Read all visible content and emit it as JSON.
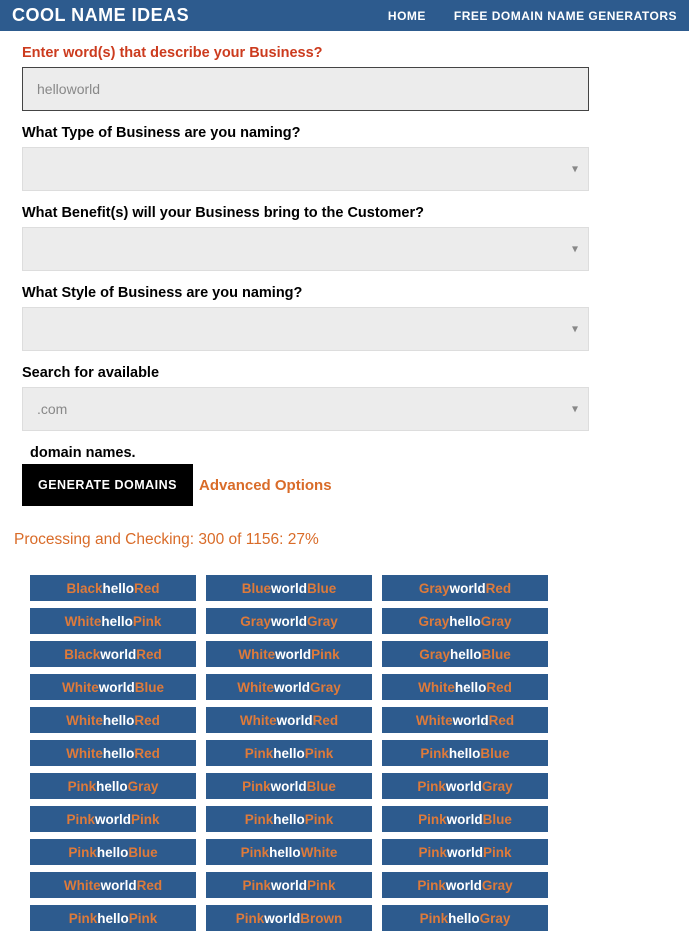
{
  "header": {
    "title": "COOL NAME IDEAS",
    "nav": {
      "home": "HOME",
      "gen": "FREE DOMAIN NAME GENERATORS"
    }
  },
  "form": {
    "q1": "Enter word(s) that describe your Business?",
    "q1_value": "helloworld",
    "q2": "What Type of Business are you naming?",
    "q3": "What Benefit(s) will your Business bring to the Customer?",
    "q4": "What Style of Business are you naming?",
    "q5": "Search for available",
    "q5_value": ".com",
    "q5_tail": "domain names.",
    "gen_btn": "GENERATE DOMAINS",
    "adv": "Advanced Options"
  },
  "status": "Processing and Checking: 300 of 1156: 27%",
  "results": {
    "col1": [
      [
        {
          "t": "Black",
          "c": "o"
        },
        {
          "t": "hello",
          "c": "w"
        },
        {
          "t": "Red",
          "c": "o"
        }
      ],
      [
        {
          "t": "White",
          "c": "o"
        },
        {
          "t": "hello",
          "c": "w"
        },
        {
          "t": "Pink",
          "c": "o"
        }
      ],
      [
        {
          "t": "Black",
          "c": "o"
        },
        {
          "t": "world",
          "c": "w"
        },
        {
          "t": "Red",
          "c": "o"
        }
      ],
      [
        {
          "t": "White",
          "c": "o"
        },
        {
          "t": "world",
          "c": "w"
        },
        {
          "t": "Blue",
          "c": "o"
        }
      ],
      [
        {
          "t": "White",
          "c": "o"
        },
        {
          "t": "hello",
          "c": "w"
        },
        {
          "t": "Red",
          "c": "o"
        }
      ],
      [
        {
          "t": "White",
          "c": "o"
        },
        {
          "t": "hello",
          "c": "w"
        },
        {
          "t": "Red",
          "c": "o"
        }
      ],
      [
        {
          "t": "Pink",
          "c": "o"
        },
        {
          "t": "hello",
          "c": "w"
        },
        {
          "t": "Gray",
          "c": "o"
        }
      ],
      [
        {
          "t": "Pink",
          "c": "o"
        },
        {
          "t": "world",
          "c": "w"
        },
        {
          "t": "Pink",
          "c": "o"
        }
      ],
      [
        {
          "t": "Pink",
          "c": "o"
        },
        {
          "t": "hello",
          "c": "w"
        },
        {
          "t": "Blue",
          "c": "o"
        }
      ],
      [
        {
          "t": "White",
          "c": "o"
        },
        {
          "t": "world",
          "c": "w"
        },
        {
          "t": "Red",
          "c": "o"
        }
      ],
      [
        {
          "t": "Pink",
          "c": "o"
        },
        {
          "t": "hello",
          "c": "w"
        },
        {
          "t": "Pink",
          "c": "o"
        }
      ]
    ],
    "col2": [
      [
        {
          "t": "Blue",
          "c": "o"
        },
        {
          "t": "world",
          "c": "w"
        },
        {
          "t": "Blue",
          "c": "o"
        }
      ],
      [
        {
          "t": "Gray",
          "c": "o"
        },
        {
          "t": "world",
          "c": "w"
        },
        {
          "t": "Gray",
          "c": "o"
        }
      ],
      [
        {
          "t": "White",
          "c": "o"
        },
        {
          "t": "world",
          "c": "w"
        },
        {
          "t": "Pink",
          "c": "o"
        }
      ],
      [
        {
          "t": "White",
          "c": "o"
        },
        {
          "t": "world",
          "c": "w"
        },
        {
          "t": "Gray",
          "c": "o"
        }
      ],
      [
        {
          "t": "White",
          "c": "o"
        },
        {
          "t": "world",
          "c": "w"
        },
        {
          "t": "Red",
          "c": "o"
        }
      ],
      [
        {
          "t": "Pink",
          "c": "o"
        },
        {
          "t": "hello",
          "c": "w"
        },
        {
          "t": "Pink",
          "c": "o"
        }
      ],
      [
        {
          "t": "Pink",
          "c": "o"
        },
        {
          "t": "world",
          "c": "w"
        },
        {
          "t": "Blue",
          "c": "o"
        }
      ],
      [
        {
          "t": "Pink",
          "c": "o"
        },
        {
          "t": "hello",
          "c": "w"
        },
        {
          "t": "Pink",
          "c": "o"
        }
      ],
      [
        {
          "t": "Pink",
          "c": "o"
        },
        {
          "t": "hello",
          "c": "w"
        },
        {
          "t": "White",
          "c": "o"
        }
      ],
      [
        {
          "t": "Pink",
          "c": "o"
        },
        {
          "t": "world",
          "c": "w"
        },
        {
          "t": "Pink",
          "c": "o"
        }
      ],
      [
        {
          "t": "Pink",
          "c": "o"
        },
        {
          "t": "world",
          "c": "w"
        },
        {
          "t": "Brown",
          "c": "o"
        }
      ]
    ],
    "col3": [
      [
        {
          "t": "Gray",
          "c": "o"
        },
        {
          "t": "world",
          "c": "w"
        },
        {
          "t": "Red",
          "c": "o"
        }
      ],
      [
        {
          "t": "Gray",
          "c": "o"
        },
        {
          "t": "hello",
          "c": "w"
        },
        {
          "t": "Gray",
          "c": "o"
        }
      ],
      [
        {
          "t": "Gray",
          "c": "o"
        },
        {
          "t": "hello",
          "c": "w"
        },
        {
          "t": "Blue",
          "c": "o"
        }
      ],
      [
        {
          "t": "White",
          "c": "o"
        },
        {
          "t": "hello",
          "c": "w"
        },
        {
          "t": "Red",
          "c": "o"
        }
      ],
      [
        {
          "t": "White",
          "c": "o"
        },
        {
          "t": "world",
          "c": "w"
        },
        {
          "t": "Red",
          "c": "o"
        }
      ],
      [
        {
          "t": "Pink",
          "c": "o"
        },
        {
          "t": "hello",
          "c": "w"
        },
        {
          "t": "Blue",
          "c": "o"
        }
      ],
      [
        {
          "t": "Pink",
          "c": "o"
        },
        {
          "t": "world",
          "c": "w"
        },
        {
          "t": "Gray",
          "c": "o"
        }
      ],
      [
        {
          "t": "Pink",
          "c": "o"
        },
        {
          "t": "world",
          "c": "w"
        },
        {
          "t": "Blue",
          "c": "o"
        }
      ],
      [
        {
          "t": "Pink",
          "c": "o"
        },
        {
          "t": "world",
          "c": "w"
        },
        {
          "t": "Pink",
          "c": "o"
        }
      ],
      [
        {
          "t": "Pink",
          "c": "o"
        },
        {
          "t": "world",
          "c": "w"
        },
        {
          "t": "Gray",
          "c": "o"
        }
      ],
      [
        {
          "t": "Pink",
          "c": "o"
        },
        {
          "t": "hello",
          "c": "w"
        },
        {
          "t": "Gray",
          "c": "o"
        }
      ]
    ]
  }
}
